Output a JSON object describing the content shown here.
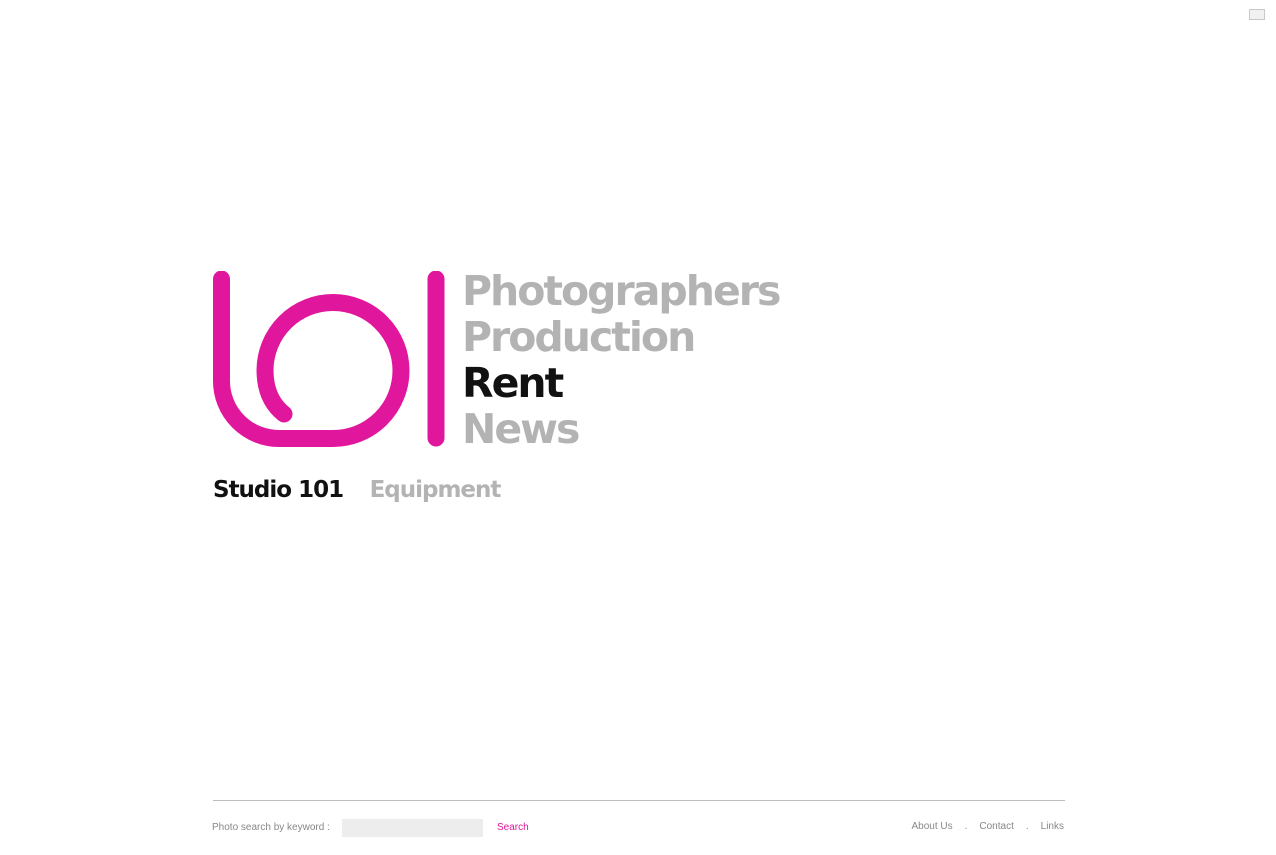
{
  "brand": {
    "accent_color": "#e0179c",
    "logo_icon": "studio-101-logo-icon"
  },
  "nav": {
    "items": [
      {
        "label": "Photographers",
        "tone": "grey"
      },
      {
        "label": "Production",
        "tone": "grey"
      },
      {
        "label": "Rent",
        "tone": "dark"
      },
      {
        "label": "News",
        "tone": "grey"
      }
    ]
  },
  "sub_nav": {
    "studio_label": "Studio 101",
    "equipment_label": "Equipment"
  },
  "footer": {
    "search_label": "Photo search by keyword :",
    "search_value": "",
    "search_button": "Search",
    "links": [
      "About Us",
      "Contact",
      "Links"
    ],
    "separator": "."
  }
}
